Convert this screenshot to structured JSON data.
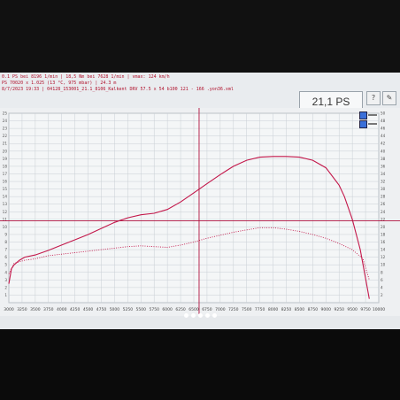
{
  "header": {
    "line1": "0.1 PS bei 8196 1/min  |  18,5 Nm bei 7628 1/min  |  vmax: 124 km/h",
    "line2": "PS 70020 x 1.025 (13 °C, 975 mbar) | 24.3 m",
    "line3": "8/7/2023 19:33 | 04128_153001_21.1_8106_Kalkent DRV 57.5 x 54 b100 121 - 166 .yon36.xml",
    "readout": "21,1 PS"
  },
  "toolbar": {
    "button1": "?",
    "button2": "✎"
  },
  "chart_data": {
    "type": "line",
    "xlabel": "",
    "ylabel": "",
    "xlim": [
      3000,
      10000
    ],
    "ylim": [
      0,
      25
    ],
    "x_ticks": [
      "3000",
      "3250",
      "3500",
      "3750",
      "4000",
      "4250",
      "4500",
      "4750",
      "5000",
      "5250",
      "5500",
      "5750",
      "6000",
      "6250",
      "6500",
      "6750",
      "7000",
      "7250",
      "7500",
      "7750",
      "8000",
      "8250",
      "8500",
      "8750",
      "9000",
      "9250",
      "9500",
      "9750",
      "10000"
    ],
    "y_ticks_left": [
      "1",
      "2",
      "3",
      "4",
      "5",
      "6",
      "7",
      "8",
      "9",
      "10",
      "11",
      "12",
      "13",
      "14",
      "15",
      "16",
      "17",
      "18",
      "19",
      "20",
      "21",
      "22",
      "23",
      "24",
      "25"
    ],
    "y_ticks_right": [
      "2",
      "4",
      "6",
      "8",
      "10",
      "12",
      "14",
      "16",
      "18",
      "20",
      "22",
      "24",
      "26",
      "28",
      "30",
      "32",
      "34",
      "36",
      "38",
      "40",
      "42",
      "44",
      "46",
      "48",
      "50"
    ],
    "cursor": {
      "rpm": 6600,
      "value": 10.8
    },
    "series": [
      {
        "style": "solid",
        "color": "#c3174a",
        "x": [
          3000,
          3050,
          3100,
          3200,
          3300,
          3500,
          3750,
          4000,
          4250,
          4500,
          4750,
          5000,
          5250,
          5500,
          5750,
          6000,
          6250,
          6500,
          6750,
          7000,
          7250,
          7500,
          7750,
          8000,
          8250,
          8500,
          8750,
          9000,
          9250,
          9350,
          9500,
          9650,
          9750,
          9820
        ],
        "y": [
          2.5,
          4.5,
          5.0,
          5.6,
          6.0,
          6.3,
          6.9,
          7.6,
          8.3,
          9.0,
          9.8,
          10.6,
          11.2,
          11.6,
          11.8,
          12.3,
          13.3,
          14.5,
          15.7,
          16.9,
          18.0,
          18.8,
          19.2,
          19.3,
          19.3,
          19.2,
          18.8,
          17.8,
          15.5,
          14.0,
          11.0,
          7.0,
          3.2,
          0.5
        ]
      },
      {
        "style": "dotted",
        "color": "#c3174a",
        "x": [
          3000,
          3100,
          3300,
          3500,
          3750,
          4000,
          4250,
          4500,
          4750,
          5000,
          5250,
          5500,
          5750,
          6000,
          6250,
          6500,
          6750,
          7000,
          7250,
          7500,
          7750,
          8000,
          8250,
          8500,
          8750,
          9000,
          9250,
          9500,
          9700,
          9820
        ],
        "y": [
          3.8,
          5.2,
          5.6,
          5.8,
          6.2,
          6.4,
          6.6,
          6.8,
          7.0,
          7.2,
          7.4,
          7.5,
          7.4,
          7.3,
          7.6,
          8.0,
          8.5,
          8.9,
          9.3,
          9.6,
          9.9,
          9.9,
          9.7,
          9.4,
          9.0,
          8.5,
          7.8,
          7.0,
          5.8,
          3.0
        ]
      }
    ]
  },
  "pager": {
    "count": 5
  }
}
